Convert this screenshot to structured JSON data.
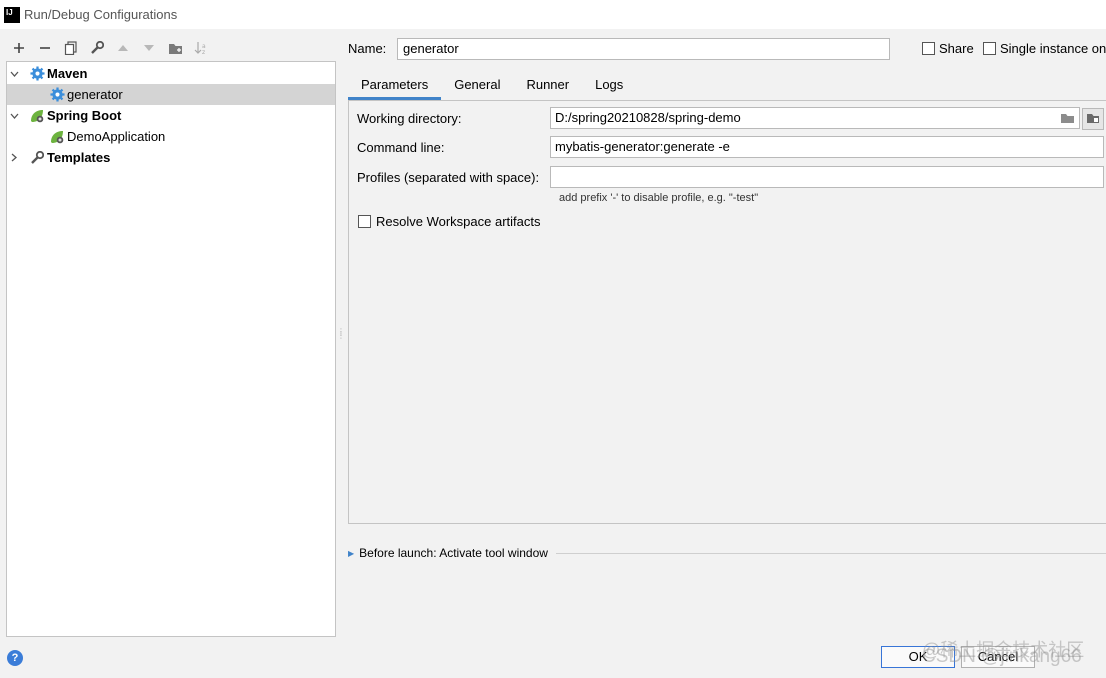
{
  "window": {
    "title": "Run/Debug Configurations",
    "app_icon_text": "IJ"
  },
  "toolbar": {
    "buttons": [
      {
        "name": "add-icon",
        "glyph": "+"
      },
      {
        "name": "remove-icon",
        "glyph": "−"
      },
      {
        "name": "copy-icon",
        "glyph": "⧉"
      },
      {
        "name": "wrench-icon",
        "glyph": "🔧"
      },
      {
        "name": "move-up-icon",
        "glyph": "▲"
      },
      {
        "name": "move-down-icon",
        "glyph": "▼"
      },
      {
        "name": "new-folder-icon",
        "glyph": "📁"
      },
      {
        "name": "sort-icon",
        "glyph": "↓a"
      }
    ]
  },
  "tree": {
    "maven": {
      "label": "Maven"
    },
    "generator": {
      "label": "generator"
    },
    "spring_boot": {
      "label": "Spring Boot"
    },
    "demo_app": {
      "label": "DemoApplication"
    },
    "templates": {
      "label": "Templates"
    }
  },
  "name_field": {
    "label": "Name:",
    "value": "generator"
  },
  "share": {
    "label": "Share",
    "checked": false
  },
  "single_instance": {
    "label": "Single instance on",
    "checked": false
  },
  "tabs": [
    "Parameters",
    "General",
    "Runner",
    "Logs"
  ],
  "active_tab": "Parameters",
  "params": {
    "working_dir": {
      "label": "Working directory:",
      "value": "D:/spring20210828/spring-demo"
    },
    "command_line": {
      "label": "Command line:",
      "value": "mybatis-generator:generate -e"
    },
    "profiles": {
      "label": "Profiles (separated with space):",
      "value": ""
    },
    "profiles_hint": "add prefix '-' to disable profile, e.g. \"-test\"",
    "resolve_workspace": {
      "label": "Resolve Workspace artifacts",
      "checked": false
    }
  },
  "before_launch": {
    "label": "Before launch: Activate tool window"
  },
  "footer": {
    "ok_label": "OK",
    "cancel_label": "Cancel",
    "help_glyph": "?"
  },
  "watermark": {
    "line1": "@稀土掘金技术社区",
    "line2": "CSDN @jinkang66"
  },
  "colors": {
    "accent": "#4083c9",
    "selection": "#d4d4d4",
    "maven_gear": "#3b8edb",
    "spring_green": "#6db33f"
  }
}
